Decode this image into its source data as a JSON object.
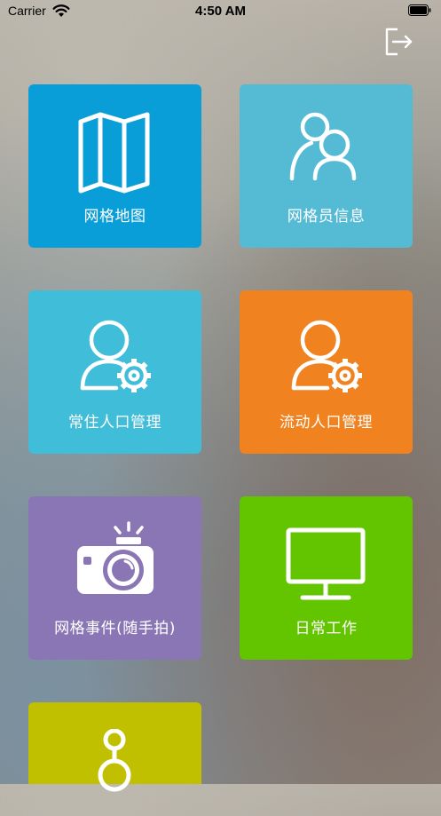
{
  "status_bar": {
    "carrier": "Carrier",
    "time": "4:50 AM"
  },
  "tiles": [
    {
      "label": "网格地图",
      "color": "#0a9ed8",
      "icon": "map-icon"
    },
    {
      "label": "网格员信息",
      "color": "#55bbd5",
      "icon": "users-icon"
    },
    {
      "label": "常住人口管理",
      "color": "#40bdd8",
      "icon": "user-gear-icon"
    },
    {
      "label": "流动人口管理",
      "color": "#f0821f",
      "icon": "user-gear-icon"
    },
    {
      "label": "网格事件(随手拍)",
      "color": "#8b76b5",
      "icon": "camera-icon"
    },
    {
      "label": "日常工作",
      "color": "#63c400",
      "icon": "monitor-icon"
    },
    {
      "label": "",
      "color": "#c1c000",
      "icon": "network-icon"
    }
  ]
}
